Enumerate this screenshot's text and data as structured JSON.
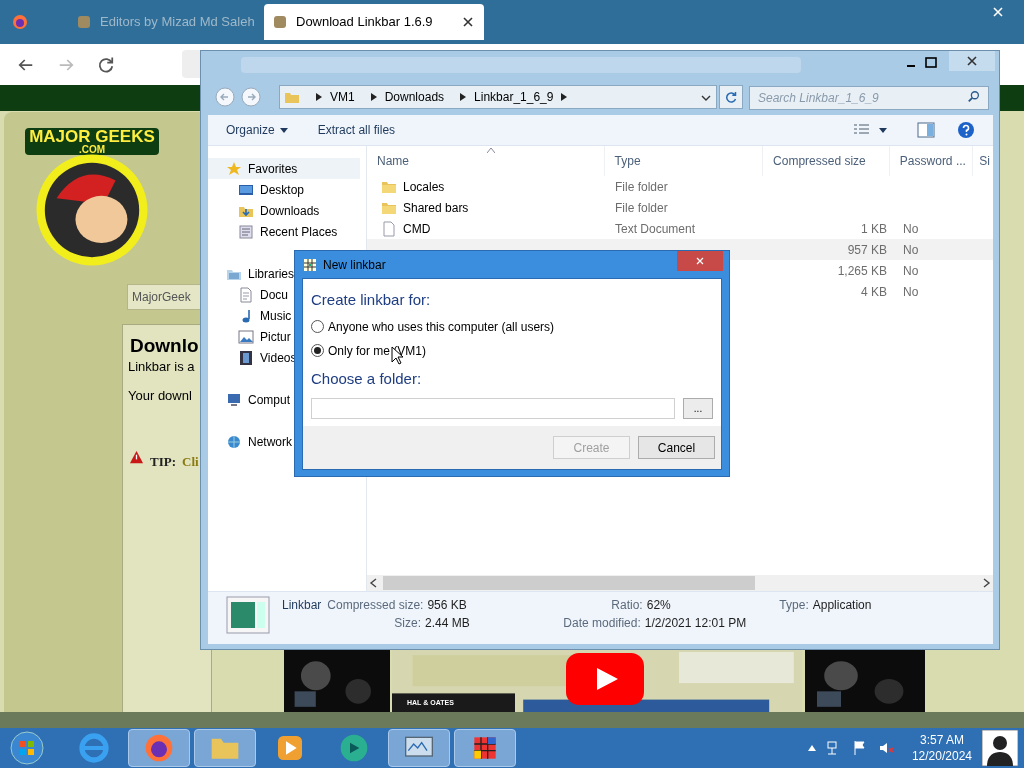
{
  "browser": {
    "tabs": [
      {
        "title": "Editors by Mizad Md Saleh",
        "selected": false
      },
      {
        "title": "Download Linkbar 1.6.9",
        "selected": true
      }
    ]
  },
  "webpage": {
    "logo_title": "MAJOR GEEKS",
    "logo_sub": ".COM",
    "search_value": "MajorGeek",
    "heading": "Downlo",
    "line_1": "Linkbar is a",
    "line_2": "Your downl",
    "tip_label": "TIP:",
    "tip_text": "Cli",
    "video_label": "HAL & OATES"
  },
  "explorer": {
    "breadcrumb": [
      "VM1",
      "Downloads",
      "Linkbar_1_6_9"
    ],
    "search": {
      "placeholder": "Search Linkbar_1_6_9"
    },
    "toolbar": [
      {
        "label": "Organize",
        "kind": "menu"
      },
      {
        "label": "Extract all files",
        "kind": "button"
      }
    ],
    "nav": [
      {
        "label": "Favorites",
        "kind": "star",
        "selected": true,
        "children": [
          {
            "label": "Desktop",
            "kind": "desktop",
            "selected": false
          },
          {
            "label": "Downloads",
            "kind": "downloads",
            "selected": false
          },
          {
            "label": "Recent Places",
            "kind": "recent",
            "selected": false
          }
        ]
      },
      {
        "label": "Libraries",
        "kind": "library",
        "selected": false,
        "children": [
          {
            "label": "Docu",
            "kind": "document",
            "selected": false
          },
          {
            "label": "Music",
            "kind": "music",
            "selected": false
          },
          {
            "label": "Pictur",
            "kind": "picture",
            "selected": false
          },
          {
            "label": "Videos",
            "kind": "video",
            "selected": false
          }
        ]
      },
      {
        "label": "Comput",
        "kind": "computer",
        "selected": false
      },
      {
        "label": "Network",
        "kind": "network",
        "selected": false
      }
    ],
    "columns": [
      "Name",
      "Type",
      "Compressed size",
      "Password ...",
      "Si"
    ],
    "rows": [
      {
        "kind": "folder",
        "name": "Locales",
        "type": "File folder",
        "selected": false
      },
      {
        "kind": "folder",
        "name": "Shared bars",
        "type": "File folder",
        "selected": false
      },
      {
        "kind": "text",
        "name": "CMD",
        "type": "Text Document",
        "size": "1 KB",
        "password": "No",
        "selected": false
      },
      {
        "kind": "none",
        "size": "957 KB",
        "password": "No",
        "selected": true
      },
      {
        "kind": "none",
        "size": "1,265 KB",
        "password": "No",
        "selected": false
      },
      {
        "kind": "none",
        "size": "4 KB",
        "password": "No",
        "selected": false
      }
    ],
    "details": {
      "name": "Linkbar",
      "fields": [
        {
          "label": "Compressed size:",
          "value": "956 KB"
        },
        {
          "label": "Size:",
          "value": "2.44 MB"
        },
        {
          "label": "Ratio:",
          "value": "62%"
        },
        {
          "label": "Date modified:",
          "value": "1/2/2021 12:01 PM"
        },
        {
          "label": "Type:",
          "value": "Application"
        }
      ]
    }
  },
  "dialog": {
    "title": "New linkbar",
    "heading": "Create linkbar for:",
    "options": [
      {
        "label": "Anyone who uses this computer (all users)",
        "selected": false
      },
      {
        "label": "Only for me (VM1)",
        "selected": true
      }
    ],
    "folder_heading": "Choose a folder:",
    "browse": "...",
    "buttons": [
      {
        "label": "Create",
        "disabled": true
      },
      {
        "label": "Cancel",
        "disabled": false
      }
    ]
  },
  "taskbar": {
    "time": "3:57 AM",
    "date": "12/20/2024"
  }
}
